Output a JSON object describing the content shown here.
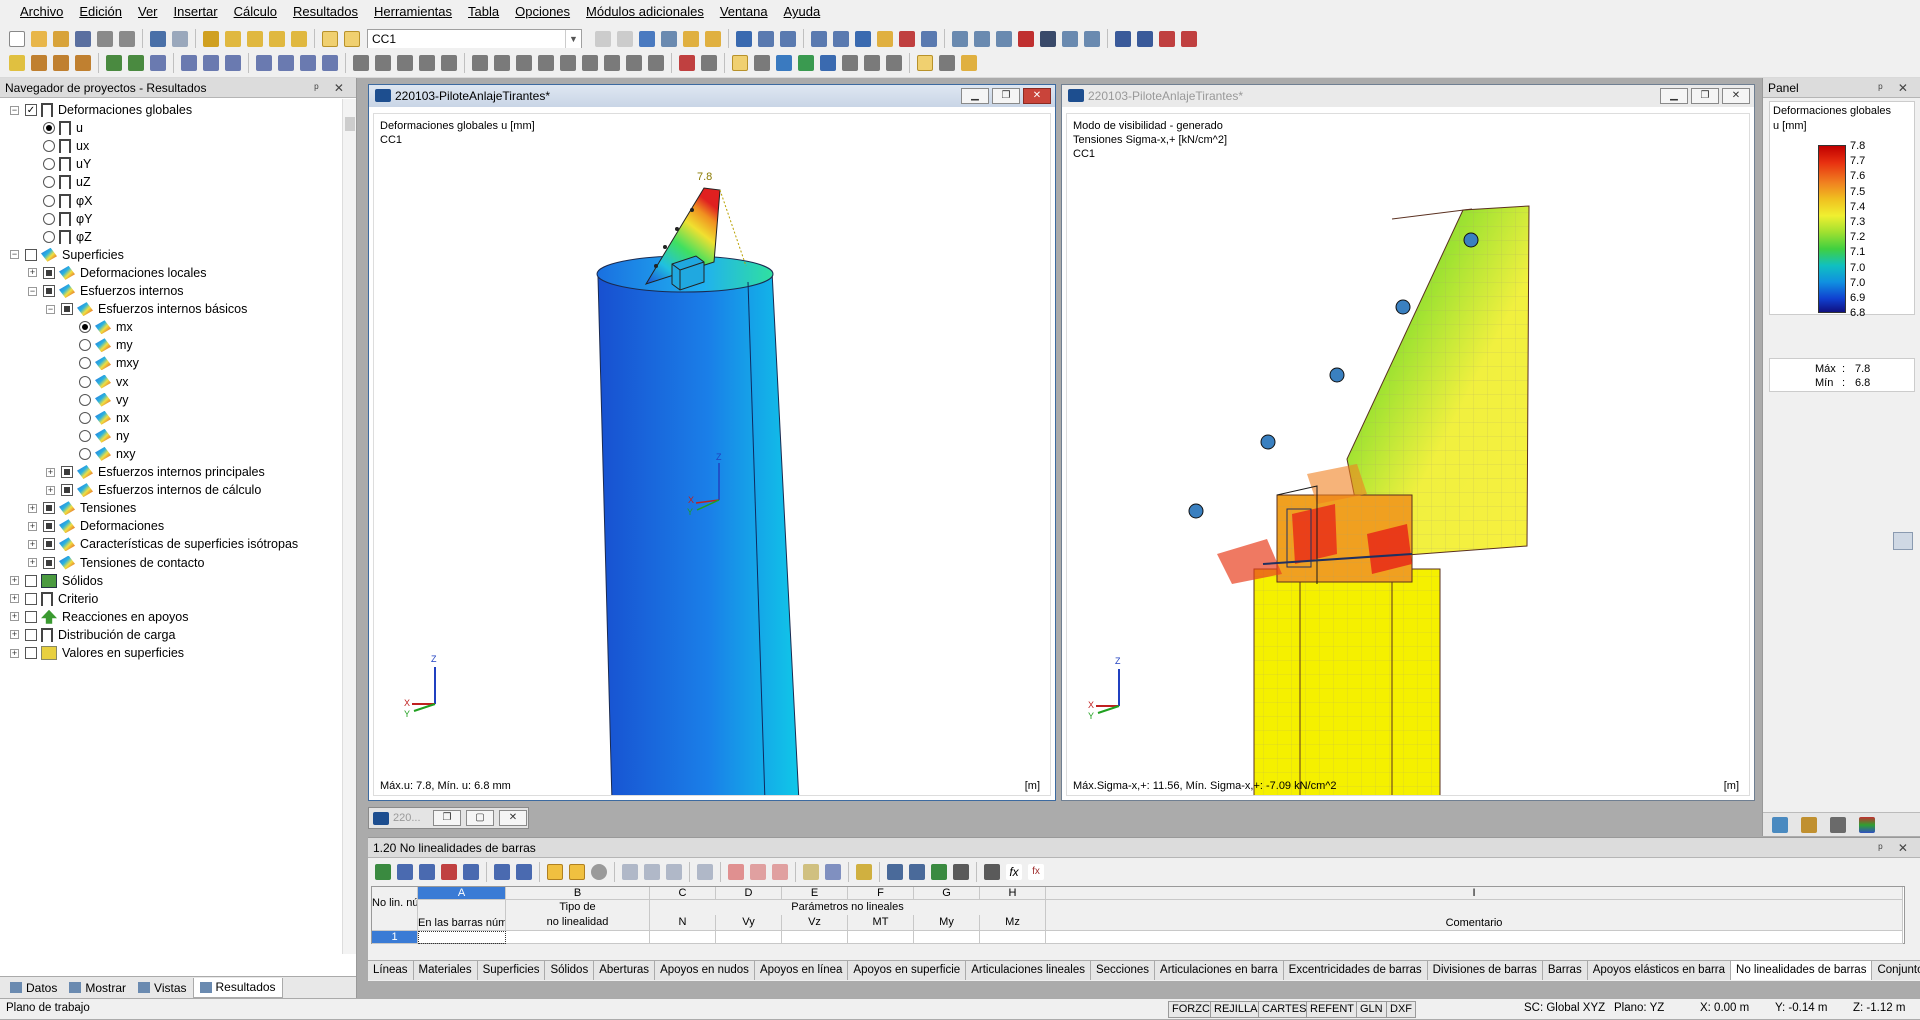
{
  "menu": [
    "Archivo",
    "Edición",
    "Ver",
    "Insertar",
    "Cálculo",
    "Resultados",
    "Herramientas",
    "Tabla",
    "Opciones",
    "Módulos adicionales",
    "Ventana",
    "Ayuda"
  ],
  "toolbar": {
    "loadcase": "CC1"
  },
  "navigator": {
    "title": "Navegador de proyectos - Resultados",
    "items": [
      {
        "label": "Deformaciones globales",
        "level": 0,
        "exp": "−",
        "ctrl": "chk-on",
        "icon": "bar"
      },
      {
        "label": "u",
        "level": 1,
        "ctrl": "rad-on",
        "icon": "bar"
      },
      {
        "label": "ux",
        "level": 1,
        "ctrl": "rad",
        "icon": "bar"
      },
      {
        "label": "uY",
        "level": 1,
        "ctrl": "rad",
        "icon": "bar"
      },
      {
        "label": "uZ",
        "level": 1,
        "ctrl": "rad",
        "icon": "bar"
      },
      {
        "label": "φX",
        "level": 1,
        "ctrl": "rad",
        "icon": "bar"
      },
      {
        "label": "φY",
        "level": 1,
        "ctrl": "rad",
        "icon": "bar"
      },
      {
        "label": "φZ",
        "level": 1,
        "ctrl": "rad",
        "icon": "bar"
      },
      {
        "label": "Superficies",
        "level": 0,
        "exp": "−",
        "ctrl": "chk",
        "icon": "surf"
      },
      {
        "label": "Deformaciones locales",
        "level": 1,
        "exp": "+",
        "ctrl": "chk-part",
        "icon": "surf"
      },
      {
        "label": "Esfuerzos internos",
        "level": 1,
        "exp": "−",
        "ctrl": "chk-part",
        "icon": "surf"
      },
      {
        "label": "Esfuerzos internos básicos",
        "level": 2,
        "exp": "−",
        "ctrl": "chk-part",
        "icon": "surf"
      },
      {
        "label": "mx",
        "level": 3,
        "ctrl": "rad-on",
        "icon": "surf"
      },
      {
        "label": "my",
        "level": 3,
        "ctrl": "rad",
        "icon": "surf"
      },
      {
        "label": "mxy",
        "level": 3,
        "ctrl": "rad",
        "icon": "surf"
      },
      {
        "label": "vx",
        "level": 3,
        "ctrl": "rad",
        "icon": "surf"
      },
      {
        "label": "vy",
        "level": 3,
        "ctrl": "rad",
        "icon": "surf"
      },
      {
        "label": "nx",
        "level": 3,
        "ctrl": "rad",
        "icon": "surf"
      },
      {
        "label": "ny",
        "level": 3,
        "ctrl": "rad",
        "icon": "surf"
      },
      {
        "label": "nxy",
        "level": 3,
        "ctrl": "rad",
        "icon": "surf"
      },
      {
        "label": "Esfuerzos internos principales",
        "level": 2,
        "exp": "+",
        "ctrl": "chk-part",
        "icon": "surf"
      },
      {
        "label": "Esfuerzos internos de cálculo",
        "level": 2,
        "exp": "+",
        "ctrl": "chk-part",
        "icon": "surf"
      },
      {
        "label": "Tensiones",
        "level": 1,
        "exp": "+",
        "ctrl": "chk-part",
        "icon": "surf"
      },
      {
        "label": "Deformaciones",
        "level": 1,
        "exp": "+",
        "ctrl": "chk-part",
        "icon": "surf"
      },
      {
        "label": "Características de superficies isótropas",
        "level": 1,
        "exp": "+",
        "ctrl": "chk-part",
        "icon": "surf"
      },
      {
        "label": "Tensiones de contacto",
        "level": 1,
        "exp": "+",
        "ctrl": "chk-part",
        "icon": "surf"
      },
      {
        "label": "Sólidos",
        "level": 0,
        "exp": "+",
        "ctrl": "chk",
        "icon": "solid"
      },
      {
        "label": "Criterio",
        "level": 0,
        "exp": "+",
        "ctrl": "chk",
        "icon": "bar"
      },
      {
        "label": "Reacciones en apoyos",
        "level": 0,
        "exp": "+",
        "ctrl": "chk",
        "icon": "supp"
      },
      {
        "label": "Distribución de carga",
        "level": 0,
        "exp": "+",
        "ctrl": "chk",
        "icon": "bar"
      },
      {
        "label": "Valores en superficies",
        "level": 0,
        "exp": "+",
        "ctrl": "chk",
        "icon": "val"
      }
    ],
    "tabs": [
      "Datos",
      "Mostrar",
      "Vistas",
      "Resultados"
    ]
  },
  "view1": {
    "title": "220103-PiloteAnlajeTirantes*",
    "line1": "Deformaciones globales u [mm]",
    "line2": "CC1",
    "max_marker": "7.8",
    "footer": "Máx.u: 7.8, Mín. u: 6.8 mm",
    "unit": "[m]"
  },
  "view2": {
    "title": "220103-PiloteAnlajeTirantes*",
    "line1": "Modo de visibilidad - generado",
    "line2": "Tensiones Sigma-x,+ [kN/cm^2]",
    "line3": "CC1",
    "footer": "Máx.Sigma-x,+: 11.56, Mín. Sigma-x,+: -7.09 kN/cm^2",
    "unit": "[m]"
  },
  "minimized_window": "220...",
  "panel": {
    "title": "Panel",
    "heading": "Deformaciones globales",
    "unit": "u [mm]",
    "scale": [
      "7.8",
      "7.7",
      "7.6",
      "7.5",
      "7.4",
      "7.3",
      "7.2",
      "7.1",
      "7.0",
      "7.0",
      "6.9",
      "6.8"
    ],
    "max_label": "Máx",
    "max_value": "7.8",
    "min_label": "Mín",
    "min_value": "6.8"
  },
  "table": {
    "title": "1.20 No linealidades de barras",
    "col_letters": [
      "A",
      "B",
      "C",
      "D",
      "E",
      "F",
      "G",
      "H",
      "I"
    ],
    "head_nolin": "No lin. núm.",
    "head_a": "En las barras núm.",
    "head_b1": "Tipo de",
    "head_b2": "no linealidad",
    "head_group": "Parámetros no lineales",
    "params": [
      "N",
      "Vy",
      "Vz",
      "MT",
      "My",
      "Mz"
    ],
    "head_i": "Comentario",
    "row1": "1"
  },
  "bottom_tabs": [
    "Líneas",
    "Materiales",
    "Superficies",
    "Sólidos",
    "Aberturas",
    "Apoyos en nudos",
    "Apoyos en línea",
    "Apoyos en superficie",
    "Articulaciones lineales",
    "Secciones",
    "Articulaciones en barra",
    "Excentricidades de barras",
    "Divisiones de barras",
    "Barras",
    "Apoyos elásticos en barra",
    "No linealidades de barras",
    "Conjuntos de barras"
  ],
  "status": {
    "left": "Plano de trabajo",
    "toggles": [
      "FORZC",
      "REJILLA",
      "CARTES",
      "REFENT",
      "GLN",
      "DXF"
    ],
    "sc": "SC: Global XYZ",
    "plane": "Plano: YZ",
    "x": "X: 0.00 m",
    "y": "Y: -0.14 m",
    "z": "Z: -1.12 m"
  },
  "colors": {
    "accent": "#1d4e8f",
    "close": "#c9443a"
  }
}
